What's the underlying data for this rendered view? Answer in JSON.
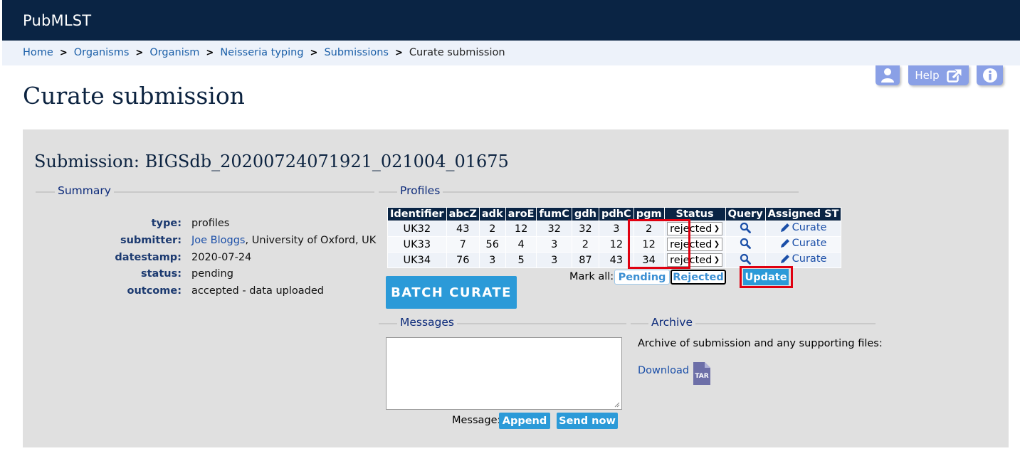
{
  "header": {
    "site_name": "PubMLST"
  },
  "breadcrumb": {
    "items": [
      "Home",
      "Organisms",
      "Organism",
      "Neisseria typing",
      "Submissions"
    ],
    "current": "Curate submission",
    "separator": ">"
  },
  "toolbar": {
    "help_label": "Help"
  },
  "page": {
    "title": "Curate submission",
    "submission_title": "Submission: BIGSdb_20200724071921_021004_01675"
  },
  "summary": {
    "legend": "Summary",
    "type_label": "type:",
    "type_value": "profiles",
    "submitter_label": "submitter:",
    "submitter_name": "Joe Bloggs",
    "submitter_affiliation": ", University of Oxford, UK",
    "datestamp_label": "datestamp:",
    "datestamp_value": "2020-07-24",
    "status_label": "status:",
    "status_value": "pending",
    "outcome_label": "outcome:",
    "outcome_value": "accepted - data uploaded"
  },
  "profiles": {
    "legend": "Profiles",
    "columns": [
      "Identifier",
      "abcZ",
      "adk",
      "aroE",
      "fumC",
      "gdh",
      "pdhC",
      "pgm",
      "Status",
      "Query",
      "Assigned ST"
    ],
    "rows": [
      {
        "id": "UK32",
        "abcZ": "43",
        "adk": "2",
        "aroE": "12",
        "fumC": "32",
        "gdh": "32",
        "pdhC": "3",
        "pgm": "2",
        "status": "rejected",
        "curate": "Curate"
      },
      {
        "id": "UK33",
        "abcZ": "7",
        "adk": "56",
        "aroE": "4",
        "fumC": "3",
        "gdh": "2",
        "pdhC": "12",
        "pgm": "12",
        "status": "rejected",
        "curate": "Curate"
      },
      {
        "id": "UK34",
        "abcZ": "76",
        "adk": "3",
        "aroE": "5",
        "fumC": "3",
        "gdh": "87",
        "pdhC": "43",
        "pgm": "34",
        "status": "rejected",
        "curate": "Curate"
      }
    ],
    "mark_all_label": "Mark all:",
    "pending_label": "Pending",
    "rejected_label": "Rejected",
    "update_label": "Update",
    "batch_curate_label": "BATCH CURATE"
  },
  "messages": {
    "legend": "Messages",
    "message_value": "",
    "message_label": "Message:",
    "append_label": "Append",
    "send_label": "Send now"
  },
  "archive": {
    "legend": "Archive",
    "text": "Archive of submission and any supporting files:",
    "download_label": "Download",
    "file_type": "TAR"
  },
  "colors": {
    "header_bg": "#0a2444",
    "breadcrumb_bg": "#edf2fa",
    "panel_bg": "#e0e0e0",
    "button_blue": "#2b9ad8",
    "highlight_red": "#e00010"
  }
}
